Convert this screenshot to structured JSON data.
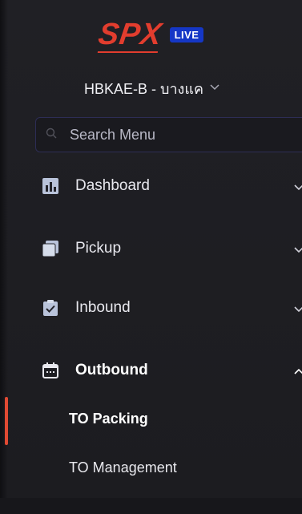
{
  "header": {
    "logo_text": "SPX",
    "live_badge": "LIVE",
    "brand_color": "#e23d2e",
    "badge_color": "#1537c6"
  },
  "station": {
    "label": "HBKAE-B - บางแค"
  },
  "search": {
    "placeholder": "Search Menu",
    "value": ""
  },
  "menu": {
    "items": [
      {
        "label": "Dashboard",
        "icon": "bar-chart-icon",
        "arrow": "chevron-down"
      },
      {
        "label": "Pickup",
        "icon": "stack-icon",
        "arrow": "chevron-down"
      },
      {
        "label": "Inbound",
        "icon": "clipboard-check-icon",
        "arrow": "chevron-down"
      },
      {
        "label": "Outbound",
        "icon": "calendar-icon",
        "arrow": "chevron-up"
      }
    ],
    "outbound_sub": [
      {
        "label": "TO Packing",
        "active": true
      },
      {
        "label": "TO Management",
        "active": false
      }
    ],
    "active_color": "#e04a33"
  }
}
